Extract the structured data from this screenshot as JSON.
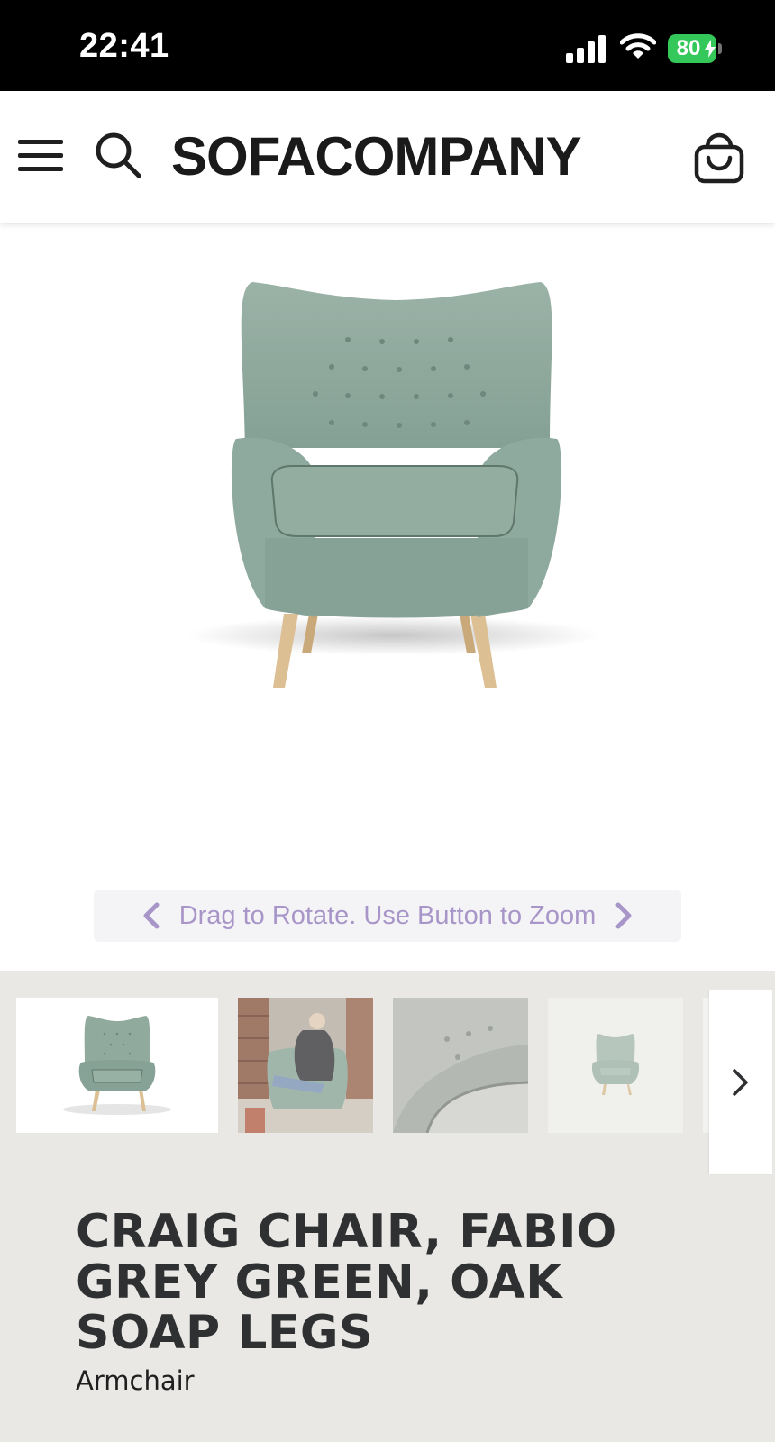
{
  "status_bar": {
    "time": "22:41",
    "battery": "80",
    "icons": [
      "signal-icon",
      "wifi-icon",
      "battery-charging-icon"
    ]
  },
  "header": {
    "logo": "SOFACOMPANY",
    "icons": [
      "hamburger-menu-icon",
      "search-icon",
      "shopping-bag-icon"
    ]
  },
  "viewer": {
    "hint": "Drag to Rotate. Use Button to Zoom",
    "hint_color": "#a896c8",
    "chair_color": "#8fa89d",
    "leg_color": "#d9b98c"
  },
  "gallery": {
    "thumbnails": [
      "Chair front view",
      "Person seated in chair",
      "Seat fabric close-up",
      "Chair small front view"
    ],
    "active_index": 0
  },
  "product": {
    "title": "CRAIG CHAIR, FABIO GREY GREEN, OAK SOAP LEGS",
    "subtitle": "Armchair"
  },
  "colors": {
    "band_background": "#e9e8e5",
    "title_text": "#2f3032"
  }
}
